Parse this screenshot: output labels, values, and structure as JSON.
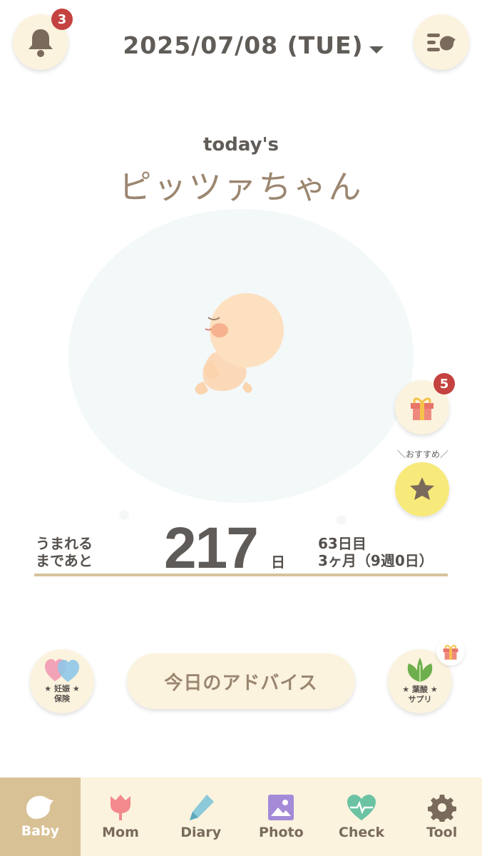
{
  "header": {
    "date": "2025/07/08 (TUE)",
    "notification_count": "3",
    "icons": {
      "left": "bell-icon",
      "right": "menu-bird-icon"
    }
  },
  "hero": {
    "todays_label": "today's",
    "baby_name": "ピッツァちゃん"
  },
  "side_buttons": {
    "gift_count": "5",
    "recommend_label": "＼おすすめ／"
  },
  "countdown": {
    "until_birth_line1": "うまれる",
    "until_birth_line2": "まであと",
    "days_remaining": "217",
    "days_unit": "日",
    "day_count": "63日目",
    "month_week": "3ヶ月（9週0日）"
  },
  "actions": {
    "insurance_line1": "★ 妊娠 ★",
    "insurance_line2": "保険",
    "advice_label": "今日のアドバイス",
    "supplement_line1": "★ 葉酸 ★",
    "supplement_line2": "サプリ"
  },
  "tabs": [
    {
      "label": "Baby",
      "color": "#ffffff"
    },
    {
      "label": "Mom",
      "color": "#f28a8d"
    },
    {
      "label": "Diary",
      "color": "#8cc9d9"
    },
    {
      "label": "Photo",
      "color": "#a58ad8"
    },
    {
      "label": "Check",
      "color": "#6bc3a3"
    },
    {
      "label": "Tool",
      "color": "#7a6a5c"
    }
  ],
  "colors": {
    "accent_beige": "#d9c196",
    "button_bg": "#fbf3de",
    "badge_red": "#c4423f",
    "star_yellow": "#f8ea7a"
  }
}
